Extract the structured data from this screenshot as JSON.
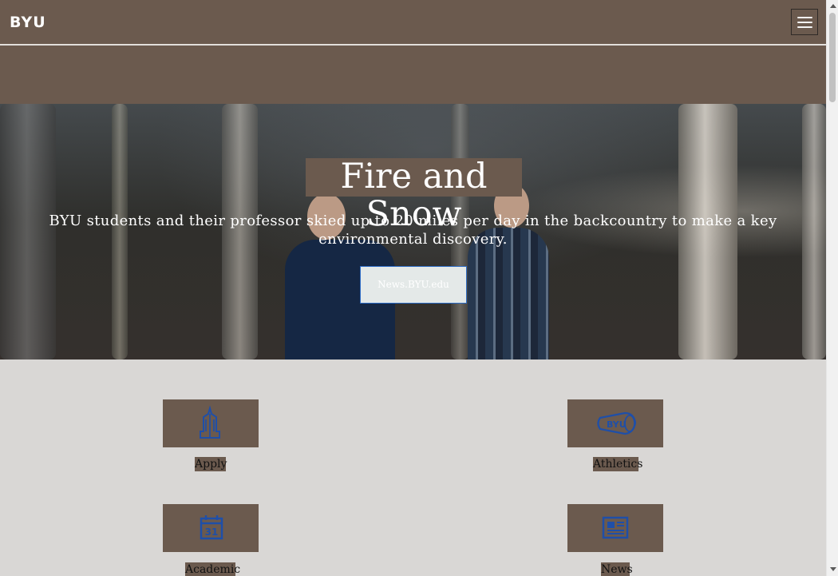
{
  "header": {
    "logo": "BYU",
    "menu_icon": "hamburger-icon"
  },
  "hero": {
    "title": "Fire and Snow",
    "description": "BYU students and their professor skied up to 20 miles per day in the backcountry to make a key environmental discovery.",
    "button_label": "News.BYU.edu"
  },
  "tiles": [
    {
      "label": "Apply",
      "icon": "graduate-icon"
    },
    {
      "label": "Athletics",
      "icon": "byu-megaphone-icon"
    },
    {
      "label": "Academic",
      "icon": "calendar-icon",
      "icon_text": "31"
    },
    {
      "label": "News",
      "icon": "newspaper-icon"
    }
  ],
  "colors": {
    "brand_brown": "#6b5a4e",
    "icon_blue": "#1f4fa8",
    "page_background": "#d9d7d5"
  }
}
